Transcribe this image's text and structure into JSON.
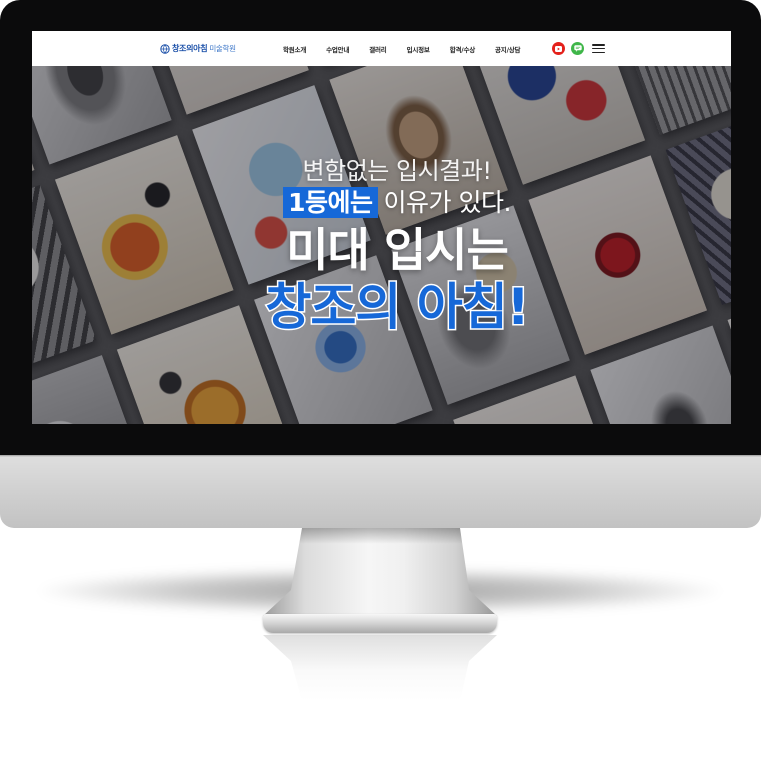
{
  "site": {
    "logo": {
      "icon": "academy-emblem-icon",
      "brand": "창조의아침",
      "suffix": "미술학원"
    },
    "nav": [
      {
        "label": "학원소개"
      },
      {
        "label": "수업안내"
      },
      {
        "label": "갤러리"
      },
      {
        "label": "입시정보"
      },
      {
        "label": "합격/수상"
      },
      {
        "label": "공지/상담"
      }
    ],
    "social": {
      "youtube": {
        "icon": "youtube-icon",
        "color": "#e4211b"
      },
      "chat": {
        "icon": "talk-chat-icon",
        "color": "#3fb649"
      }
    },
    "menu": {
      "icon": "hamburger-menu-icon"
    }
  },
  "hero": {
    "line1": "변함없는 입시결과!",
    "highlight": "1등에는",
    "line2_rest": "이유가 있다.",
    "line3": "미대 입시는",
    "line4": "창조의 아침!"
  },
  "colors": {
    "accent": "#1668d8",
    "header_bg": "#ffffff",
    "bezel": "#0b0b0c",
    "chin": "#d3d3d3"
  }
}
